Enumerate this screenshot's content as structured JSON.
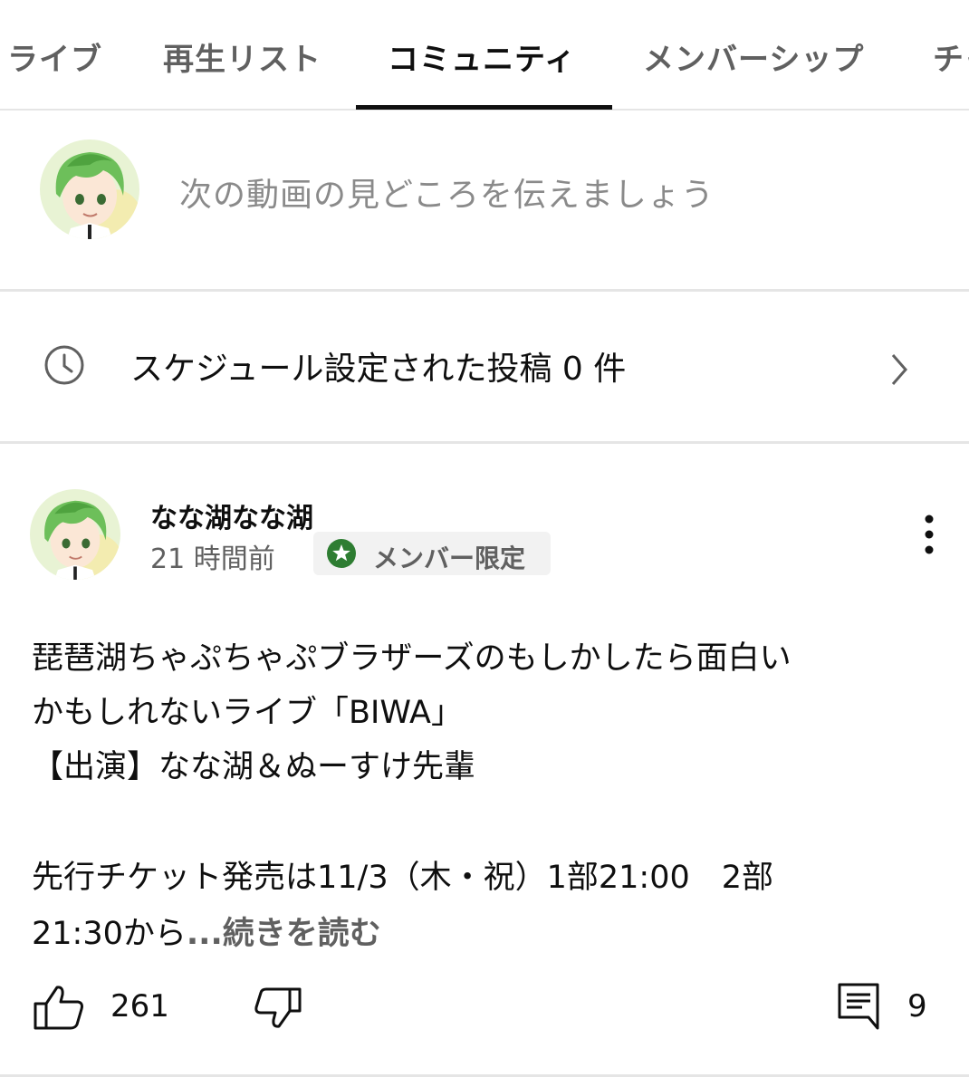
{
  "tabs": [
    {
      "label": "ライブ",
      "active": false
    },
    {
      "label": "再生リスト",
      "active": false
    },
    {
      "label": "コミュニティ",
      "active": true
    },
    {
      "label": "メンバーシップ",
      "active": false
    },
    {
      "label": "チャ",
      "active": false
    }
  ],
  "composer": {
    "placeholder": "次の動画の見どころを伝えましょう",
    "avatar_icon": "user-avatar-icon"
  },
  "scheduled": {
    "label": "スケジュール設定された投稿 0 件",
    "icon": "clock-icon",
    "chevron": "chevron-right-icon"
  },
  "post": {
    "author": "なな湖なな湖",
    "time": "21 時間前",
    "badge": "メンバー限定",
    "badge_color": "#2e7d32",
    "lines": [
      "琵琶湖ちゃぷちゃぷブラザーズのもしかしたら面白い",
      "かもしれないライブ「BIWA」",
      "【出演】なな湖＆ぬーすけ先輩",
      "",
      "先行チケット発売は11/3（木・祝）1部21:00　2部"
    ],
    "last_line": "21:30から",
    "read_more": "...続きを読む",
    "likes": "261",
    "comments": "9"
  }
}
